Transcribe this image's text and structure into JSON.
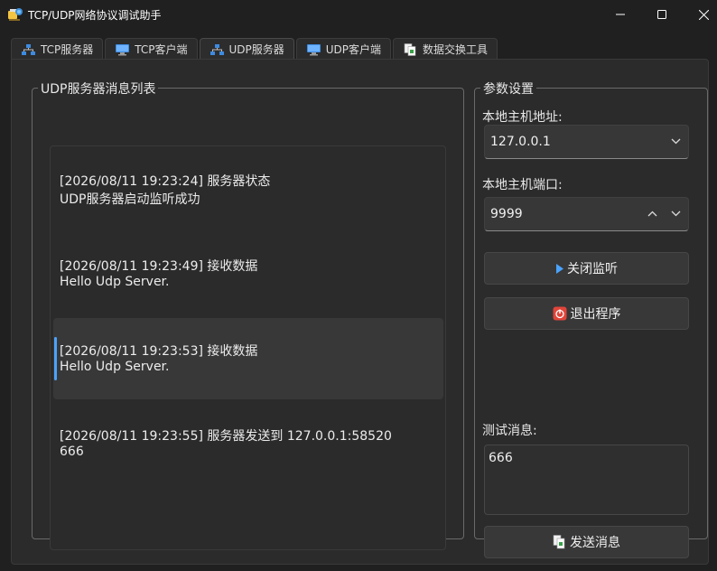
{
  "window": {
    "title": "TCP/UDP网络协议调试助手",
    "controls": [
      "minimize",
      "maximize",
      "close"
    ]
  },
  "tabs": [
    {
      "label": "TCP服务器",
      "icon": "network-icon",
      "active": false
    },
    {
      "label": "TCP客户端",
      "icon": "monitor-icon",
      "active": false
    },
    {
      "label": "UDP服务器",
      "icon": "network-icon",
      "active": true
    },
    {
      "label": "UDP客户端",
      "icon": "monitor-icon",
      "active": false
    },
    {
      "label": "数据交换工具",
      "icon": "documents-icon",
      "active": false
    }
  ],
  "messages_group": {
    "title": "UDP服务器消息列表",
    "items": [
      {
        "line1": "[2026/08/11 19:23:24] 服务器状态",
        "line2": "UDP服务器启动监听成功",
        "selected": false
      },
      {
        "line1": "[2026/08/11 19:23:49] 接收数据",
        "line2": "Hello Udp Server.",
        "selected": false
      },
      {
        "line1": "[2026/08/11 19:23:53] 接收数据",
        "line2": "Hello Udp Server.",
        "selected": true
      },
      {
        "line1": "[2026/08/11 19:23:55] 服务器发送到 127.0.0.1:58520",
        "line2": "666",
        "selected": false
      }
    ]
  },
  "settings_group": {
    "title": "参数设置",
    "host_label": "本地主机地址:",
    "host_value": "127.0.0.1",
    "port_label": "本地主机端口:",
    "port_value": "9999",
    "stop_button": "关闭监听",
    "exit_button": "退出程序",
    "test_label": "测试消息:",
    "test_value": "666",
    "send_button": "发送消息"
  },
  "colors": {
    "accent": "#4aa3ff",
    "exit_icon": "#e0453a"
  }
}
